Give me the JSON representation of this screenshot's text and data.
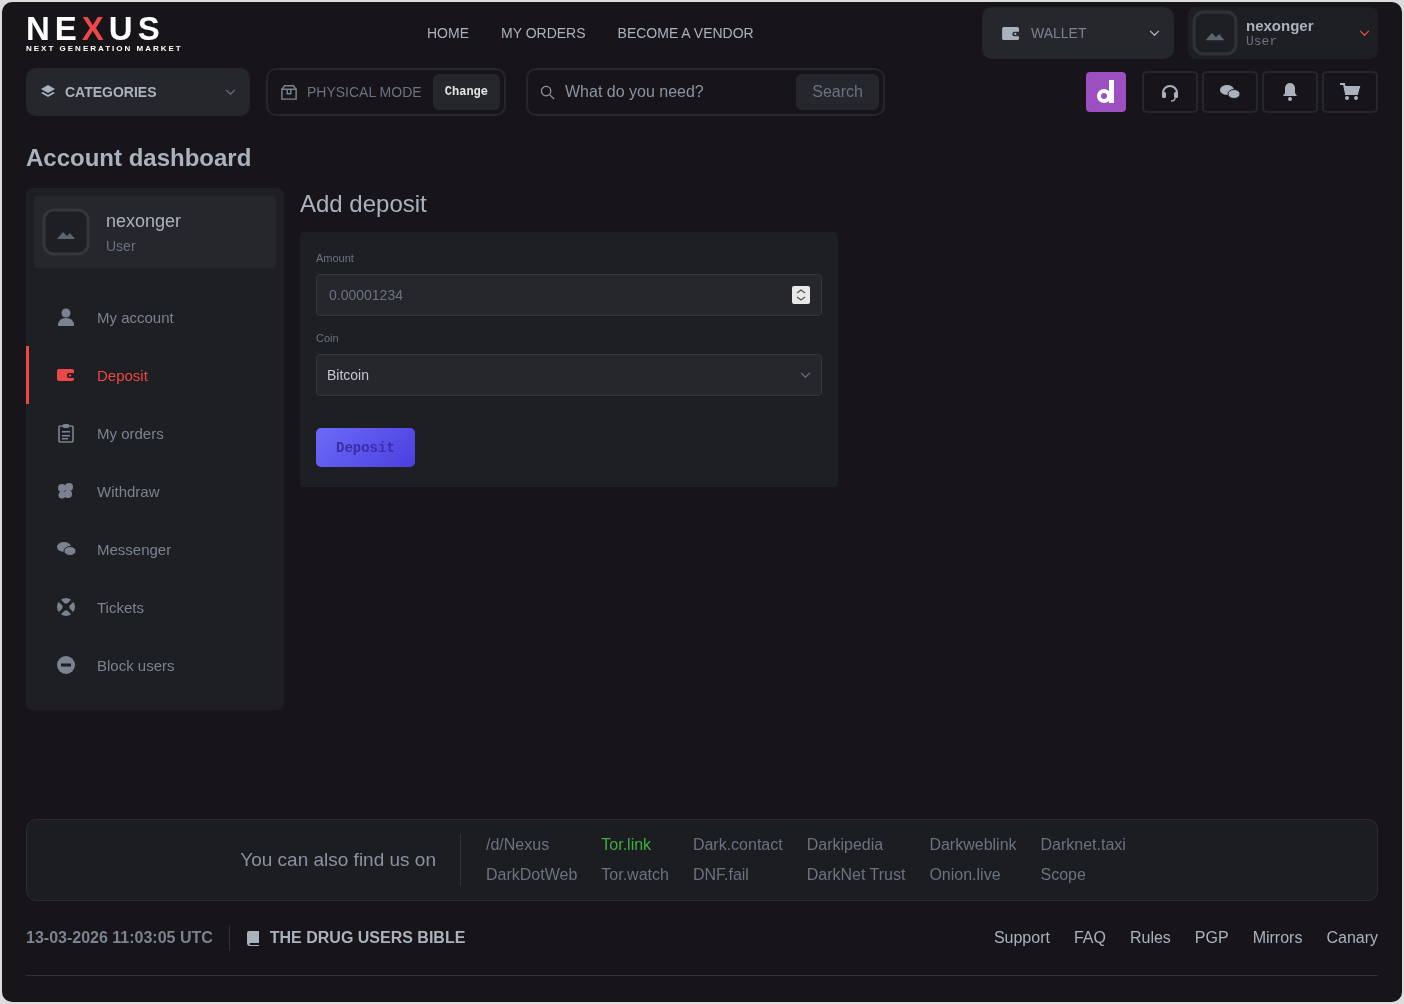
{
  "logo": {
    "before": "NE",
    "accent": "X",
    "after": "US",
    "tagline": "NEXT GENERATION MARKET"
  },
  "nav": [
    "HOME",
    "MY ORDERS",
    "BECOME A VENDOR"
  ],
  "wallet": {
    "label": "WALLET"
  },
  "user": {
    "name": "nexonger",
    "role": "User"
  },
  "categories": {
    "label": "CATEGORIES"
  },
  "mode": {
    "label": "PHYSICAL MODE",
    "button": "Change"
  },
  "search": {
    "placeholder": "What do you need?",
    "button": "Search"
  },
  "page_title": "Account dashboard",
  "sidebar": {
    "user": {
      "name": "nexonger",
      "role": "User"
    },
    "items": [
      {
        "label": "My account",
        "selected": false
      },
      {
        "label": "Deposit",
        "selected": true
      },
      {
        "label": "My orders",
        "selected": false
      },
      {
        "label": "Withdraw",
        "selected": false
      },
      {
        "label": "Messenger",
        "selected": false
      },
      {
        "label": "Tickets",
        "selected": false
      },
      {
        "label": "Block users",
        "selected": false
      }
    ]
  },
  "deposit": {
    "title": "Add deposit",
    "amount_label": "Amount",
    "amount_placeholder": "0.00001234",
    "coin_label": "Coin",
    "coin_value": "Bitcoin",
    "button": "Deposit"
  },
  "mirrors": {
    "heading": "You can also find us on",
    "links": [
      {
        "label": "/d/Nexus",
        "color": "#6b7280"
      },
      {
        "label": "Tor.link",
        "color": "#3fae3f"
      },
      {
        "label": "Dark.contact",
        "color": "#6b7280"
      },
      {
        "label": "Darkipedia",
        "color": "#6b7280"
      },
      {
        "label": "Darkweblink",
        "color": "#6b7280"
      },
      {
        "label": "Darknet.taxi",
        "color": "#6b7280"
      },
      {
        "label": "DarkDotWeb",
        "color": "#6b7280"
      },
      {
        "label": "Tor.watch",
        "color": "#6b7280"
      },
      {
        "label": "DNF.fail",
        "color": "#6b7280"
      },
      {
        "label": "DarkNet Trust",
        "color": "#6b7280"
      },
      {
        "label": "Onion.live",
        "color": "#6b7280"
      },
      {
        "label": "Scope",
        "color": "#6b7280"
      }
    ]
  },
  "footer": {
    "datetime": "13-03-2026 11:03:05 UTC",
    "bible": "THE DRUG USERS BIBLE",
    "links": [
      "Support",
      "FAQ",
      "Rules",
      "PGP",
      "Mirrors",
      "Canary"
    ]
  }
}
